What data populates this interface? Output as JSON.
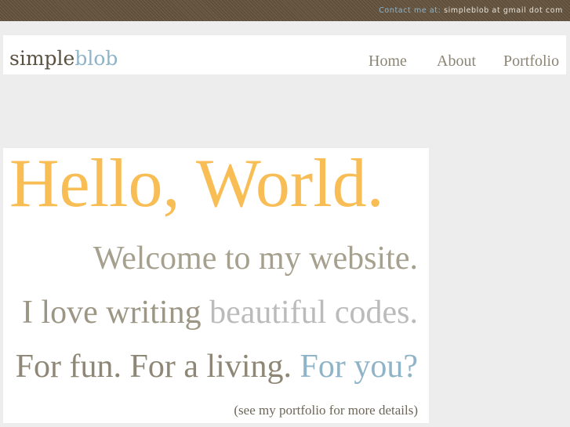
{
  "topbar": {
    "contact_label": "Contact me at:",
    "contact_email": "simpleblob at gmail dot com"
  },
  "header": {
    "logo_part1": "simple",
    "logo_part2": "blob",
    "nav": [
      {
        "label": "Home"
      },
      {
        "label": "About"
      },
      {
        "label": "Portfolio"
      }
    ]
  },
  "hero": {
    "headline": "Hello, World.",
    "welcome": "Welcome to my website.",
    "love_part1": "I love writing",
    "love_part2": "beautiful codes.",
    "fun_part1": "For fun. For a living.",
    "fun_part2": "For you?",
    "portfolio_note": "(see my portfolio for more details)"
  },
  "colors": {
    "accent_orange": "#f8be55",
    "accent_blue": "#8fb4c8",
    "topbar_brown": "#6b5a45",
    "text_taupe": "#a6a08e"
  }
}
